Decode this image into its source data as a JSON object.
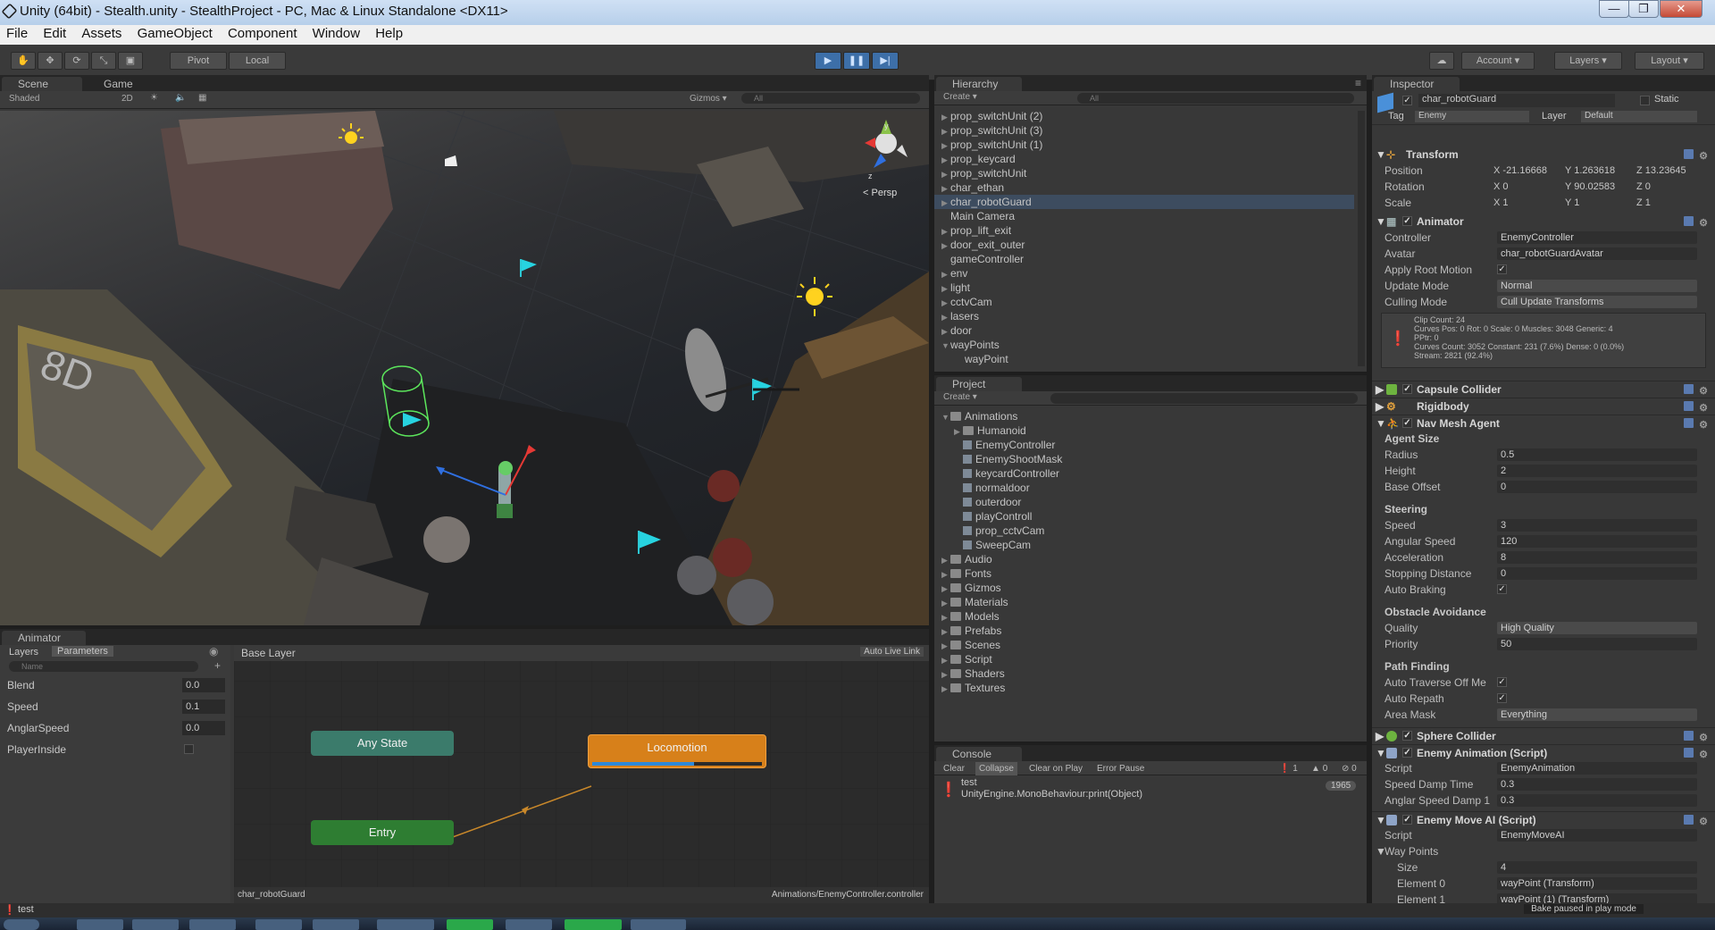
{
  "window": {
    "title": "Unity (64bit) - Stealth.unity - StealthProject - PC, Mac & Linux Standalone <DX11>",
    "minimize": "—",
    "maximize": "❐",
    "close": "✕"
  },
  "menu": [
    "File",
    "Edit",
    "Assets",
    "GameObject",
    "Component",
    "Window",
    "Help"
  ],
  "toolbar": {
    "pivot": "Pivot",
    "local": "Local",
    "account": "Account",
    "layers": "Layers",
    "layout": "Layout"
  },
  "scene": {
    "tab_scene": "Scene",
    "tab_game": "Game",
    "shading": "Shaded",
    "mode_2d": "2D",
    "gizmos": "Gizmos",
    "search_placeholder": "All",
    "persp": "Persp"
  },
  "hierarchy": {
    "tab": "Hierarchy",
    "create": "Create",
    "search_placeholder": "All",
    "items": [
      {
        "label": "prop_switchUnit (2)",
        "fold": "▶"
      },
      {
        "label": "prop_switchUnit (3)",
        "fold": "▶"
      },
      {
        "label": "prop_switchUnit (1)",
        "fold": "▶"
      },
      {
        "label": "prop_keycard",
        "fold": "▶"
      },
      {
        "label": "prop_switchUnit",
        "fold": "▶"
      },
      {
        "label": "char_ethan",
        "fold": "▶"
      },
      {
        "label": "char_robotGuard",
        "fold": "▶"
      },
      {
        "label": "Main Camera",
        "fold": ""
      },
      {
        "label": "prop_lift_exit",
        "fold": "▶"
      },
      {
        "label": "door_exit_outer",
        "fold": "▶"
      },
      {
        "label": "gameController",
        "fold": ""
      },
      {
        "label": "env",
        "fold": "▶"
      },
      {
        "label": "light",
        "fold": "▶"
      },
      {
        "label": "cctvCam",
        "fold": "▶"
      },
      {
        "label": "lasers",
        "fold": "▶"
      },
      {
        "label": "door",
        "fold": "▶"
      },
      {
        "label": "wayPoints",
        "fold": "▼"
      },
      {
        "label": "wayPoint",
        "fold": ""
      }
    ]
  },
  "project": {
    "tab": "Project",
    "create": "Create",
    "items": [
      {
        "label": "Animations",
        "fold": "▼",
        "indent": 0,
        "kind": "folder"
      },
      {
        "label": "Humanoid",
        "fold": "▶",
        "indent": 1,
        "kind": "folder"
      },
      {
        "label": "EnemyController",
        "fold": "",
        "indent": 1,
        "kind": "asset"
      },
      {
        "label": "EnemyShootMask",
        "fold": "",
        "indent": 1,
        "kind": "asset"
      },
      {
        "label": "keycardController",
        "fold": "",
        "indent": 1,
        "kind": "asset"
      },
      {
        "label": "normaldoor",
        "fold": "",
        "indent": 1,
        "kind": "asset"
      },
      {
        "label": "outerdoor",
        "fold": "",
        "indent": 1,
        "kind": "asset"
      },
      {
        "label": "playControll",
        "fold": "",
        "indent": 1,
        "kind": "asset"
      },
      {
        "label": "prop_cctvCam",
        "fold": "",
        "indent": 1,
        "kind": "asset"
      },
      {
        "label": "SweepCam",
        "fold": "",
        "indent": 1,
        "kind": "asset"
      },
      {
        "label": "Audio",
        "fold": "▶",
        "indent": 0,
        "kind": "folder"
      },
      {
        "label": "Fonts",
        "fold": "▶",
        "indent": 0,
        "kind": "folder"
      },
      {
        "label": "Gizmos",
        "fold": "▶",
        "indent": 0,
        "kind": "folder"
      },
      {
        "label": "Materials",
        "fold": "▶",
        "indent": 0,
        "kind": "folder"
      },
      {
        "label": "Models",
        "fold": "▶",
        "indent": 0,
        "kind": "folder"
      },
      {
        "label": "Prefabs",
        "fold": "▶",
        "indent": 0,
        "kind": "folder"
      },
      {
        "label": "Scenes",
        "fold": "▶",
        "indent": 0,
        "kind": "folder"
      },
      {
        "label": "Script",
        "fold": "▶",
        "indent": 0,
        "kind": "folder"
      },
      {
        "label": "Shaders",
        "fold": "▶",
        "indent": 0,
        "kind": "folder"
      },
      {
        "label": "Textures",
        "fold": "▶",
        "indent": 0,
        "kind": "folder"
      }
    ]
  },
  "console": {
    "tab": "Console",
    "clear": "Clear",
    "collapse": "Collapse",
    "clear_on_play": "Clear on Play",
    "error_pause": "Error Pause",
    "info_count": "1",
    "warn_count": "0",
    "error_count": "0",
    "entry_line1": "test",
    "entry_line2": "UnityEngine.MonoBehaviour:print(Object)",
    "entry_count": "1965"
  },
  "animator": {
    "tab": "Animator",
    "layers_tab": "Layers",
    "parameters_tab": "Parameters",
    "search_placeholder": "Name",
    "breadcrumb": "Base Layer",
    "auto_live_link": "Auto Live Link",
    "params": [
      {
        "name": "Blend",
        "value": "0.0"
      },
      {
        "name": "Speed",
        "value": "0.1"
      },
      {
        "name": "AnglarSpeed",
        "value": "0.0"
      },
      {
        "name": "PlayerInside",
        "value": ""
      }
    ],
    "states": {
      "any_state": "Any State",
      "entry": "Entry",
      "locomotion": "Locomotion"
    },
    "locomotion_progress": 0.6,
    "footer_left": "char_robotGuard",
    "footer_right": "Animations/EnemyController.controller"
  },
  "inspector": {
    "tab": "Inspector",
    "object_name": "char_robotGuard",
    "static_label": "Static",
    "tag_label": "Tag",
    "tag_value": "Enemy",
    "layer_label": "Layer",
    "layer_value": "Default",
    "transform": {
      "title": "Transform",
      "position_label": "Position",
      "rotation_label": "Rotation",
      "scale_label": "Scale",
      "position": {
        "x": "-21.16668",
        "y": "1.263618",
        "z": "13.23645"
      },
      "rotation": {
        "x": "0",
        "y": "90.02583",
        "z": "0"
      },
      "scale": {
        "x": "1",
        "y": "1",
        "z": "1"
      }
    },
    "animator": {
      "title": "Animator",
      "controller_label": "Controller",
      "controller_value": "EnemyController",
      "avatar_label": "Avatar",
      "avatar_value": "char_robotGuardAvatar",
      "apply_root_motion_label": "Apply Root Motion",
      "update_mode_label": "Update Mode",
      "update_mode_value": "Normal",
      "culling_mode_label": "Culling Mode",
      "culling_mode_value": "Cull Update Transforms",
      "info_line1": "Clip Count: 24",
      "info_line2": "Curves Pos: 0 Rot: 0 Scale: 0 Muscles: 3048 Generic: 4",
      "info_line3": "PPtr: 0",
      "info_line4": "Curves Count: 3052 Constant: 231 (7.6%) Dense: 0 (0.0%)",
      "info_line5": "Stream: 2821 (92.4%)"
    },
    "capsule_collider": "Capsule Collider",
    "rigidbody": "Rigidbody",
    "nav_mesh_agent": {
      "title": "Nav Mesh Agent",
      "agent_size": "Agent Size",
      "radius_label": "Radius",
      "radius": "0.5",
      "height_label": "Height",
      "height": "2",
      "base_offset_label": "Base Offset",
      "base_offset": "0",
      "steering": "Steering",
      "speed_label": "Speed",
      "speed": "3",
      "angular_speed_label": "Angular Speed",
      "angular_speed": "120",
      "acceleration_label": "Acceleration",
      "acceleration": "8",
      "stopping_distance_label": "Stopping Distance",
      "stopping_distance": "0",
      "auto_braking_label": "Auto Braking",
      "obstacle_avoidance": "Obstacle Avoidance",
      "quality_label": "Quality",
      "quality": "High Quality",
      "priority_label": "Priority",
      "priority": "50",
      "path_finding": "Path Finding",
      "auto_traverse_label": "Auto Traverse Off Me",
      "auto_repath_label": "Auto Repath",
      "area_mask_label": "Area Mask",
      "area_mask": "Everything"
    },
    "sphere_collider": "Sphere Collider",
    "enemy_animation": {
      "title": "Enemy Animation (Script)",
      "script_label": "Script",
      "script_value": "EnemyAnimation",
      "speed_damp_label": "Speed Damp Time",
      "speed_damp": "0.3",
      "anglar_speed_damp_label": "Anglar Speed Damp 1",
      "anglar_speed_damp": "0.3"
    },
    "enemy_move_ai": {
      "title": "Enemy Move AI (Script)",
      "script_label": "Script",
      "script_value": "EnemyMoveAI",
      "way_points_label": "Way Points",
      "size_label": "Size",
      "size": "4",
      "element0_label": "Element 0",
      "element0": "wayPoint (Transform)",
      "element1_label": "Element 1",
      "element1": "wayPoint (1) (Transform)"
    }
  },
  "status": {
    "message": "test",
    "bake_status": "Bake paused in play mode"
  },
  "colors": {
    "accent_blue": "#3d6fa8",
    "state_teal": "#3b7b6b",
    "state_green": "#2e7d32",
    "state_orange": "#d7801a"
  }
}
